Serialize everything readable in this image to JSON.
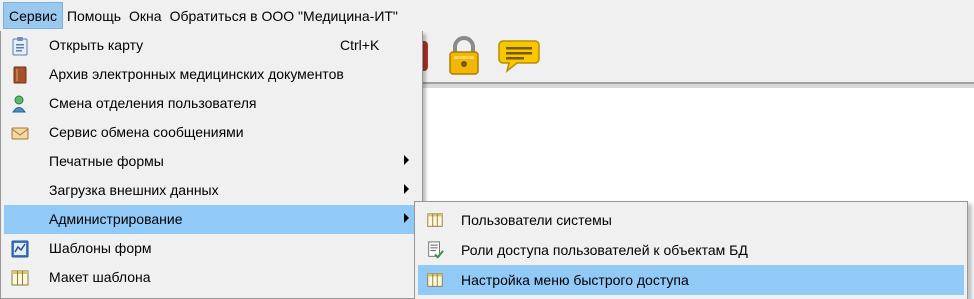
{
  "menubar": {
    "items": [
      {
        "label": "Сервис"
      },
      {
        "label": "Помощь"
      },
      {
        "label": "Окна"
      },
      {
        "label": "Обратиться в ООО \"Медицина-ИТ\""
      }
    ]
  },
  "service_menu": {
    "items": [
      {
        "label": "Открыть карту",
        "shortcut": "Ctrl+K",
        "icon": "clipboard-icon"
      },
      {
        "label": "Архив электронных медицинских документов",
        "icon": "book-icon"
      },
      {
        "label": "Смена отделения пользователя",
        "icon": "user-icon"
      },
      {
        "label": "Сервис обмена сообщениями",
        "icon": "envelope-icon"
      },
      {
        "label": "Печатные формы",
        "has_submenu": true
      },
      {
        "label": "Загрузка внешних данных",
        "has_submenu": true
      },
      {
        "label": "Администрирование",
        "has_submenu": true,
        "highlighted": true
      },
      {
        "label": "Шаблоны форм",
        "icon": "form-template-icon"
      },
      {
        "label": "Макет шаблона",
        "icon": "grid-icon"
      }
    ]
  },
  "admin_submenu": {
    "items": [
      {
        "label": "Пользователи системы",
        "icon": "grid-icon"
      },
      {
        "label": "Роли доступа пользователей к объектам БД",
        "icon": "document-check-icon"
      },
      {
        "label": "Настройка меню быстрого доступа",
        "icon": "grid-icon",
        "highlighted": true
      }
    ]
  },
  "toolbar": {
    "icons": [
      "lock-icon",
      "message-icon"
    ]
  },
  "colors": {
    "highlight": "#91c9f7",
    "menu_background": "#f0f0f0"
  }
}
